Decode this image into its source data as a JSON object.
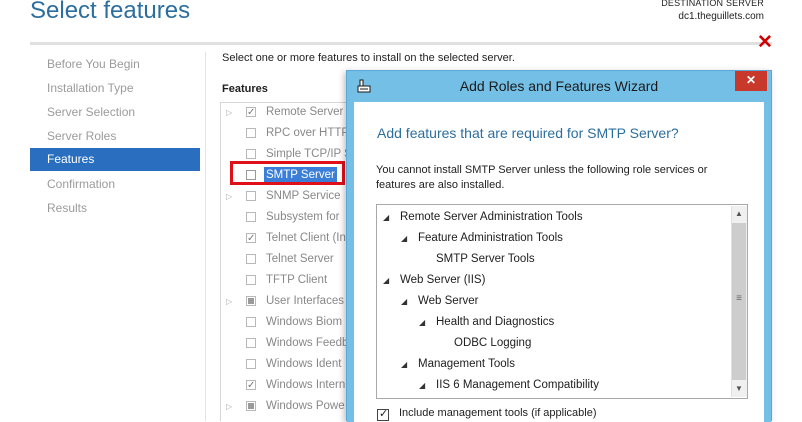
{
  "header": {
    "title": "Select features",
    "destination_label": "DESTINATION SERVER",
    "destination_server": "dc1.theguillets.com",
    "close_symbol": "✕",
    "close_color": "#d00000"
  },
  "nav": {
    "items": [
      {
        "label": "Before You Begin",
        "active": false
      },
      {
        "label": "Installation Type",
        "active": false
      },
      {
        "label": "Server Selection",
        "active": false
      },
      {
        "label": "Server Roles",
        "active": false
      },
      {
        "label": "Features",
        "active": true
      },
      {
        "label": "Confirmation",
        "active": false
      },
      {
        "label": "Results",
        "active": false
      }
    ],
    "active_color": "#2a6fbf"
  },
  "main": {
    "instruction": "Select one or more features to install on the selected server.",
    "features_label": "Features",
    "features": [
      {
        "label": "Remote Server",
        "state": "checked",
        "expander": true
      },
      {
        "label": "RPC over HTTP",
        "state": "unchecked",
        "expander": false
      },
      {
        "label": "Simple TCP/IP S",
        "state": "unchecked",
        "expander": false
      },
      {
        "label": "SMTP Server",
        "state": "unchecked",
        "expander": false,
        "selected": true
      },
      {
        "label": "SNMP Service",
        "state": "unchecked",
        "expander": true
      },
      {
        "label": "Subsystem for",
        "state": "unchecked",
        "expander": false
      },
      {
        "label": "Telnet Client (In",
        "state": "checked",
        "expander": false
      },
      {
        "label": "Telnet Server",
        "state": "unchecked",
        "expander": false
      },
      {
        "label": "TFTP Client",
        "state": "unchecked",
        "expander": false
      },
      {
        "label": "User Interfaces",
        "state": "partial",
        "expander": true
      },
      {
        "label": "Windows Biom",
        "state": "unchecked",
        "expander": false
      },
      {
        "label": "Windows Feedb",
        "state": "unchecked",
        "expander": false
      },
      {
        "label": "Windows Ident",
        "state": "unchecked",
        "expander": false
      },
      {
        "label": "Windows Intern",
        "state": "checked",
        "expander": false
      },
      {
        "label": "Windows Powe",
        "state": "partial",
        "expander": true
      }
    ],
    "highlight_color": "#e0101a"
  },
  "dialog": {
    "title": "Add Roles and Features Wizard",
    "close_symbol": "✕",
    "heading": "Add features that are required for SMTP Server?",
    "message": "You cannot install SMTP Server unless the following role services or features are also installed.",
    "tree": [
      {
        "label": "Remote Server Administration Tools",
        "level": 0,
        "arrow": true
      },
      {
        "label": "Feature Administration Tools",
        "level": 1,
        "arrow": true
      },
      {
        "label": "SMTP Server Tools",
        "level": 2,
        "arrow": false
      },
      {
        "label": "Web Server (IIS)",
        "level": 0,
        "arrow": true
      },
      {
        "label": "Web Server",
        "level": 1,
        "arrow": true
      },
      {
        "label": "Health and Diagnostics",
        "level": 2,
        "arrow": true
      },
      {
        "label": "ODBC Logging",
        "level": 3,
        "arrow": false
      },
      {
        "label": "Management Tools",
        "level": 1,
        "arrow": true
      },
      {
        "label": "IIS 6 Management Compatibility",
        "level": 2,
        "arrow": true
      }
    ],
    "include_tools_label": "Include management tools (if applicable)",
    "include_tools_checked": true,
    "titlebar_color": "#74bfe6"
  }
}
